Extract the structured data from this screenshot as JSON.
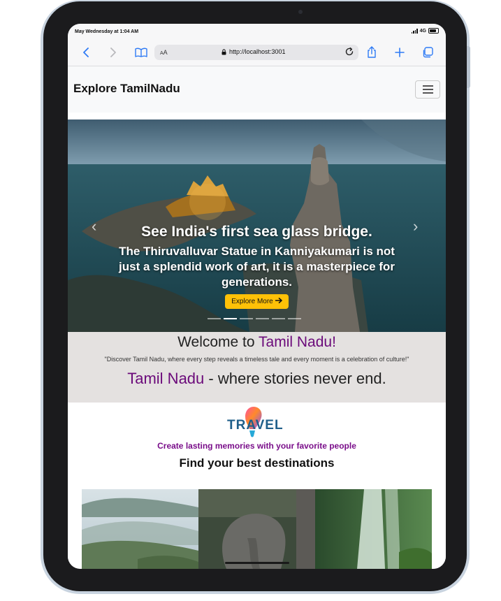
{
  "statusbar": {
    "time": "May Wednesday at 1:04 AM",
    "network": "4G"
  },
  "browser": {
    "text_size_label": "A",
    "text_size_label_large": "A",
    "url": "http://localhost:3001"
  },
  "navbar": {
    "brand": "Explore TamilNadu"
  },
  "carousel": {
    "title": "See India's first sea glass bridge.",
    "text": "The Thiruvalluvar Statue in Kanniyakumari is not just a splendid work of art, it is a masterpiece for generations.",
    "button_label": "Explore More",
    "active_slide": 2,
    "slide_count": 6
  },
  "welcome": {
    "heading_prefix": "Welcome to ",
    "heading_highlight": "Tamil Nadu!",
    "quote": "\"Discover Tamil Nadu, where every step reveals a timeless tale and every moment is a celebration of culture!\"",
    "tagline_highlight": "Tamil Nadu",
    "tagline_rest": " - where stories never end."
  },
  "travel": {
    "logo_text": "TRAVEL",
    "subtitle": "Create lasting memories with your favorite people",
    "heading": "Find your best destinations"
  },
  "gallery": [
    {
      "name": "hills-tea-estate"
    },
    {
      "name": "elephant"
    },
    {
      "name": "waterfall"
    }
  ],
  "colors": {
    "highlight": "#6b0a7a",
    "button": "#ffc107",
    "welcome_bg": "#e4e1e0",
    "ios_blue": "#2f7bf5"
  }
}
